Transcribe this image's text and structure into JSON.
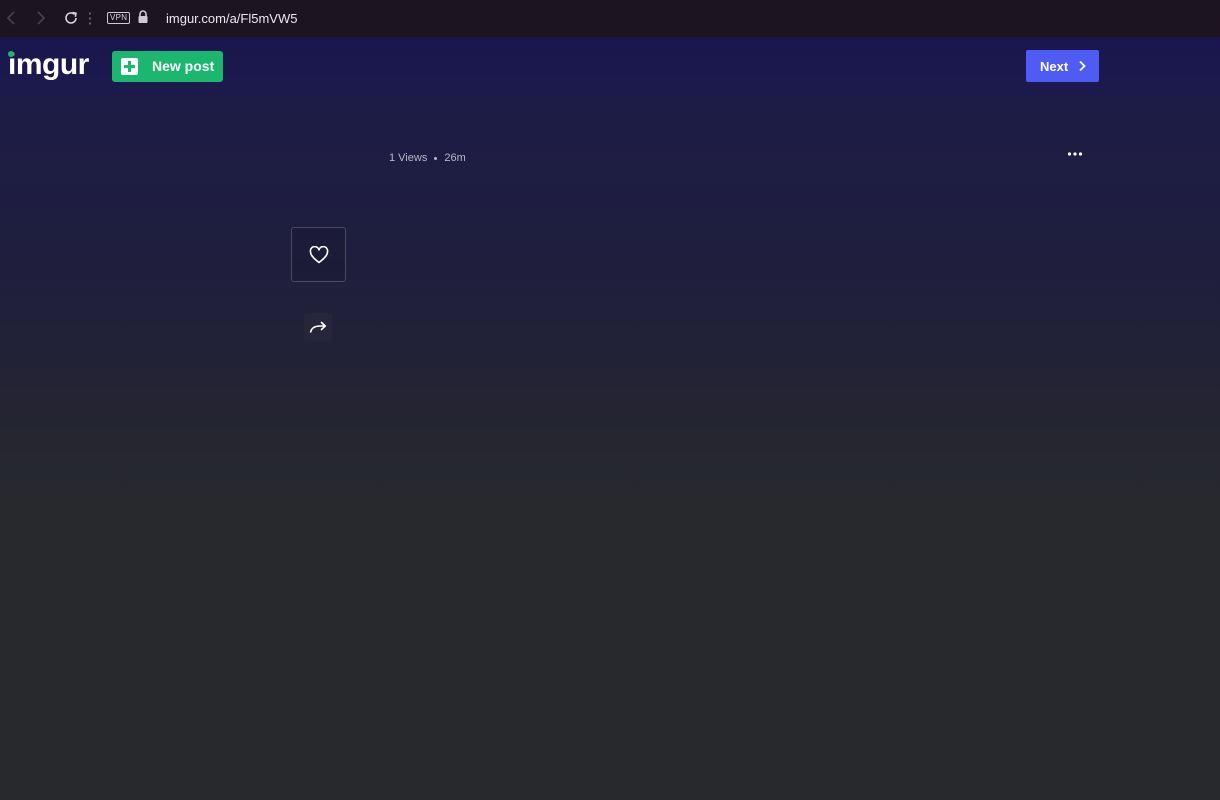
{
  "browser": {
    "vpn_label": "VPN",
    "url": "imgur.com/a/Fl5mVW5"
  },
  "header": {
    "logo_text": "imgur",
    "new_post_label": "New post",
    "next_label": "Next"
  },
  "post": {
    "views": "1 Views",
    "age": "26m"
  },
  "colors": {
    "brand_green": "#1bb76e",
    "next_blue": "#4e5cf4"
  },
  "icons": [
    "back-icon",
    "forward-icon",
    "reload-icon",
    "lock-icon",
    "plus-icon",
    "chevron-right-icon",
    "more-icon",
    "heart-icon",
    "share-icon"
  ]
}
